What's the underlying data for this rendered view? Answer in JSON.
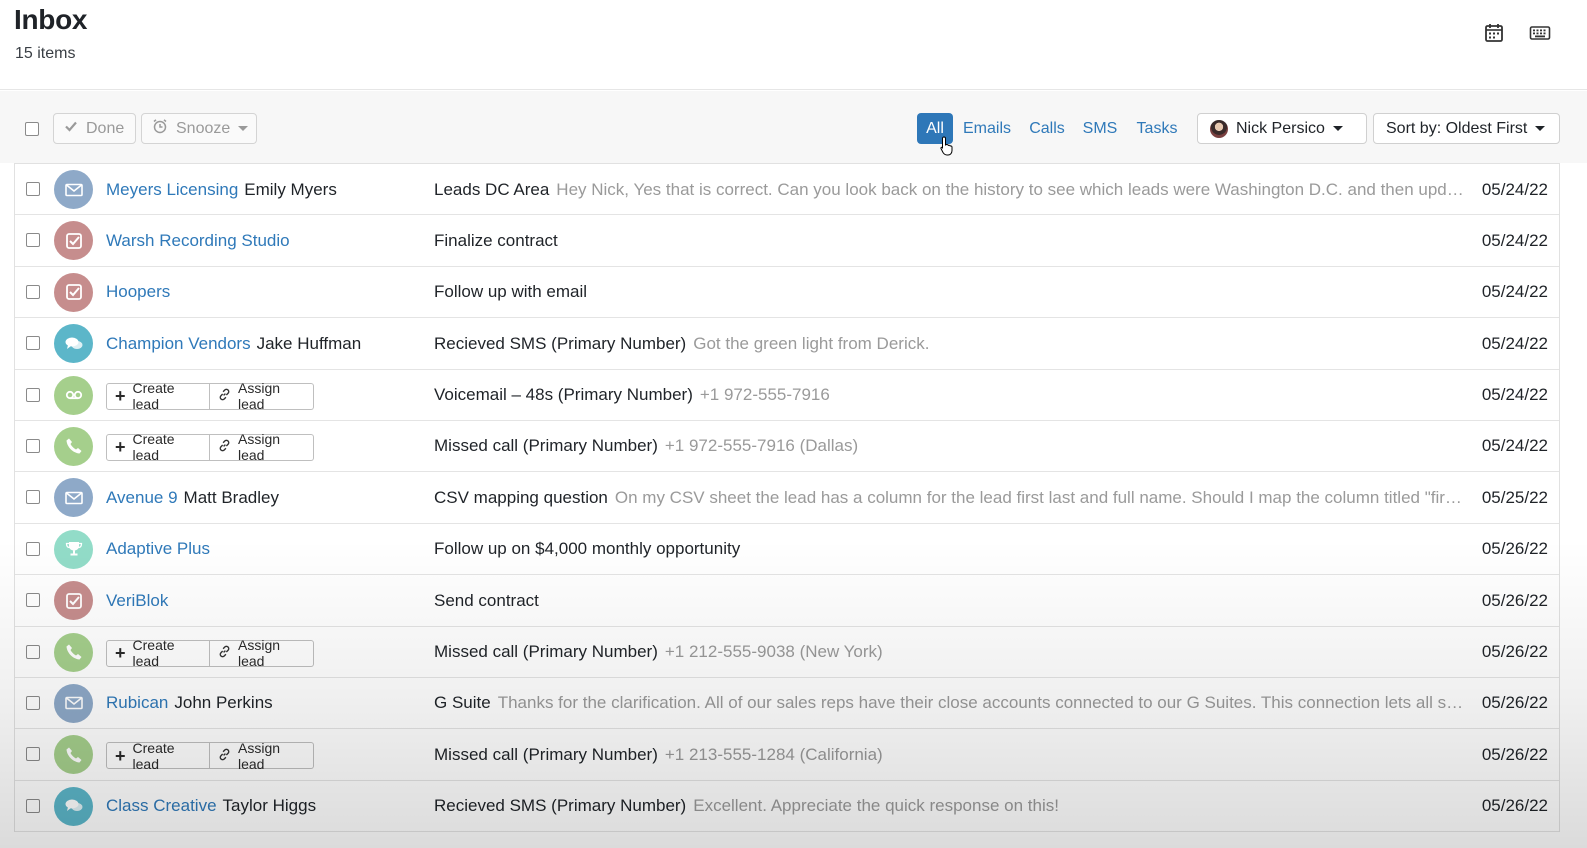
{
  "header": {
    "title": "Inbox",
    "count_label": "15 items",
    "calendar_icon": "calendar-icon",
    "keyboard_icon": "keyboard-icon"
  },
  "toolbar": {
    "done_label": "Done",
    "snooze_label": "Snooze",
    "filters": [
      "All",
      "Emails",
      "Calls",
      "SMS",
      "Tasks"
    ],
    "active_filter": "All",
    "user_label": "Nick Persico",
    "sort_label": "Sort by: Oldest First"
  },
  "rows": [
    {
      "type": "email",
      "company": "Meyers Licensing",
      "person": "Emily Myers",
      "subject": "Leads DC Area",
      "preview": "Hey Nick, Yes that is correct. Can you look back on the history to see which leads were Washington D.C. and then update the lead status accordingly",
      "date": "05/24/22"
    },
    {
      "type": "task",
      "company": "Warsh Recording Studio",
      "person": "",
      "subject": "Finalize contract",
      "preview": "",
      "date": "05/24/22"
    },
    {
      "type": "task",
      "company": "Hoopers",
      "person": "",
      "subject": "Follow up with email",
      "preview": "",
      "date": "05/24/22"
    },
    {
      "type": "sms",
      "company": "Champion Vendors",
      "person": "Jake Huffman",
      "subject": "Recieved SMS (Primary Number)",
      "preview": "Got the green light from Derick.",
      "date": "05/24/22"
    },
    {
      "type": "voicemail",
      "create_label": "Create lead",
      "assign_label": "Assign lead",
      "subject": "Voicemail – 48s (Primary Number)",
      "preview": " +1 972-555-7916",
      "date": "05/24/22"
    },
    {
      "type": "call",
      "create_label": "Create lead",
      "assign_label": "Assign lead",
      "subject": "Missed call (Primary Number)",
      "preview": "+1 972-555-7916 (Dallas)",
      "date": "05/24/22"
    },
    {
      "type": "email",
      "company": "Avenue 9",
      "person": "Matt Bradley",
      "subject": "CSV mapping question",
      "preview": "On my CSV sheet the lead has a column for the lead first last and full name. Should I map the column titled \"first name\" as well",
      "date": "05/25/22"
    },
    {
      "type": "opportunity",
      "company": "Adaptive Plus",
      "person": "",
      "subject": "Follow up on $4,000 monthly opportunity",
      "preview": "",
      "date": "05/26/22"
    },
    {
      "type": "task",
      "company": "VeriBlok",
      "person": "",
      "subject": "Send contract",
      "preview": "",
      "date": "05/26/22"
    },
    {
      "type": "call",
      "create_label": "Create lead",
      "assign_label": "Assign lead",
      "subject": "Missed call (Primary Number)",
      "preview": "+1 212-555-9038 (New York)",
      "date": "05/26/22"
    },
    {
      "type": "email",
      "company": "Rubican",
      "person": "John Perkins",
      "subject": "G Suite",
      "preview": "Thanks for the clarification. All of our sales reps have their close accounts connected to our G Suites. This connection lets all sender emails sync",
      "date": "05/26/22"
    },
    {
      "type": "call",
      "create_label": "Create lead",
      "assign_label": "Assign lead",
      "subject": "Missed call (Primary Number)",
      "preview": "+1 213-555-1284 (California)",
      "date": "05/26/22"
    },
    {
      "type": "sms",
      "company": "Class Creative",
      "person": "Taylor Higgs",
      "subject": "Recieved SMS (Primary Number)",
      "preview": "Excellent. Appreciate the quick response on this!",
      "date": "05/26/22"
    }
  ],
  "colors": {
    "link_blue": "#2f79b9",
    "active_filter_bg": "#2e77b8",
    "email_icon": "#8ea9c8",
    "task_icon": "#c68d8d",
    "sms_icon": "#5cb6c9",
    "call_icon": "#a5cf8c",
    "opportunity_icon": "#92dcc8"
  }
}
